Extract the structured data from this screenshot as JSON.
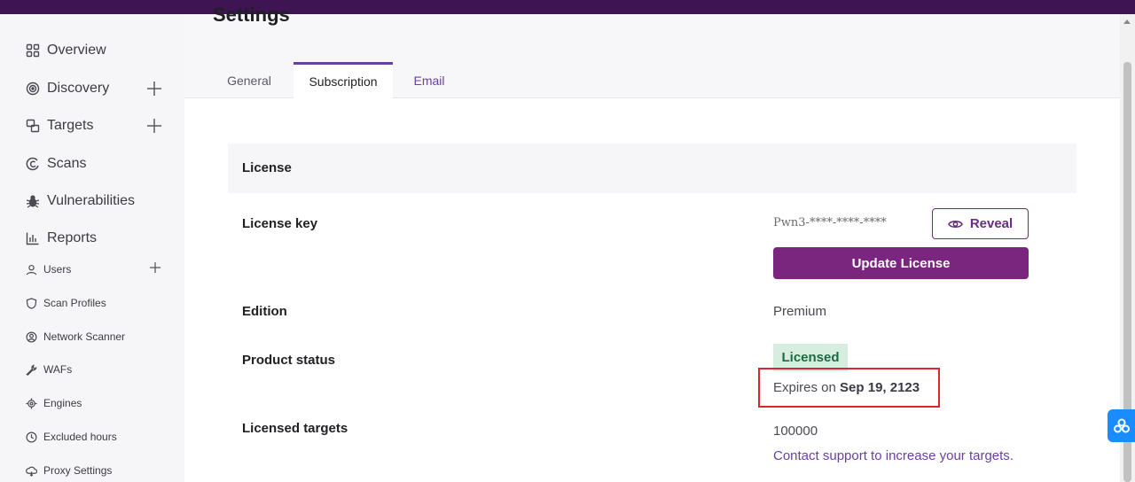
{
  "sidebar": {
    "items": [
      {
        "label": "Overview",
        "icon": "grid-icon"
      },
      {
        "label": "Discovery",
        "icon": "target-rings-icon",
        "expandable": true
      },
      {
        "label": "Targets",
        "icon": "targets-icon",
        "expandable": true
      },
      {
        "label": "Scans",
        "icon": "scans-icon"
      },
      {
        "label": "Vulnerabilities",
        "icon": "bug-icon"
      },
      {
        "label": "Reports",
        "icon": "bar-chart-icon"
      },
      {
        "label": "Users",
        "icon": "user-icon",
        "expandable": true
      },
      {
        "label": "Scan Profiles",
        "icon": "shield-icon"
      },
      {
        "label": "Network Scanner",
        "icon": "network-scanner-icon"
      },
      {
        "label": "WAFs",
        "icon": "wrench-icon"
      },
      {
        "label": "Engines",
        "icon": "engine-icon"
      },
      {
        "label": "Excluded hours",
        "icon": "clock-icon"
      },
      {
        "label": "Proxy Settings",
        "icon": "proxy-icon"
      }
    ]
  },
  "page": {
    "title": "Settings"
  },
  "tabs": [
    {
      "label": "General",
      "active": false
    },
    {
      "label": "Subscription",
      "active": true
    },
    {
      "label": "Email",
      "active": false
    }
  ],
  "license": {
    "section_title": "License",
    "key_label": "License key",
    "key_value": "Pwn3-****-****-****",
    "reveal_label": "Reveal",
    "update_label": "Update License",
    "edition_label": "Edition",
    "edition_value": "Premium",
    "status_label": "Product status",
    "status_value": "Licensed",
    "expires_prefix": "Expires on",
    "expires_date": "Sep 19, 2123",
    "targets_label": "Licensed targets",
    "targets_value": "100000",
    "support_link": "Contact support to increase your targets."
  },
  "colors": {
    "topbar": "#3e1452",
    "accent": "#7a267f",
    "tab_accent": "#6b3fa0",
    "badge_bg": "#d7ede0",
    "badge_text": "#1b6b40",
    "highlight": "#d9272d"
  }
}
